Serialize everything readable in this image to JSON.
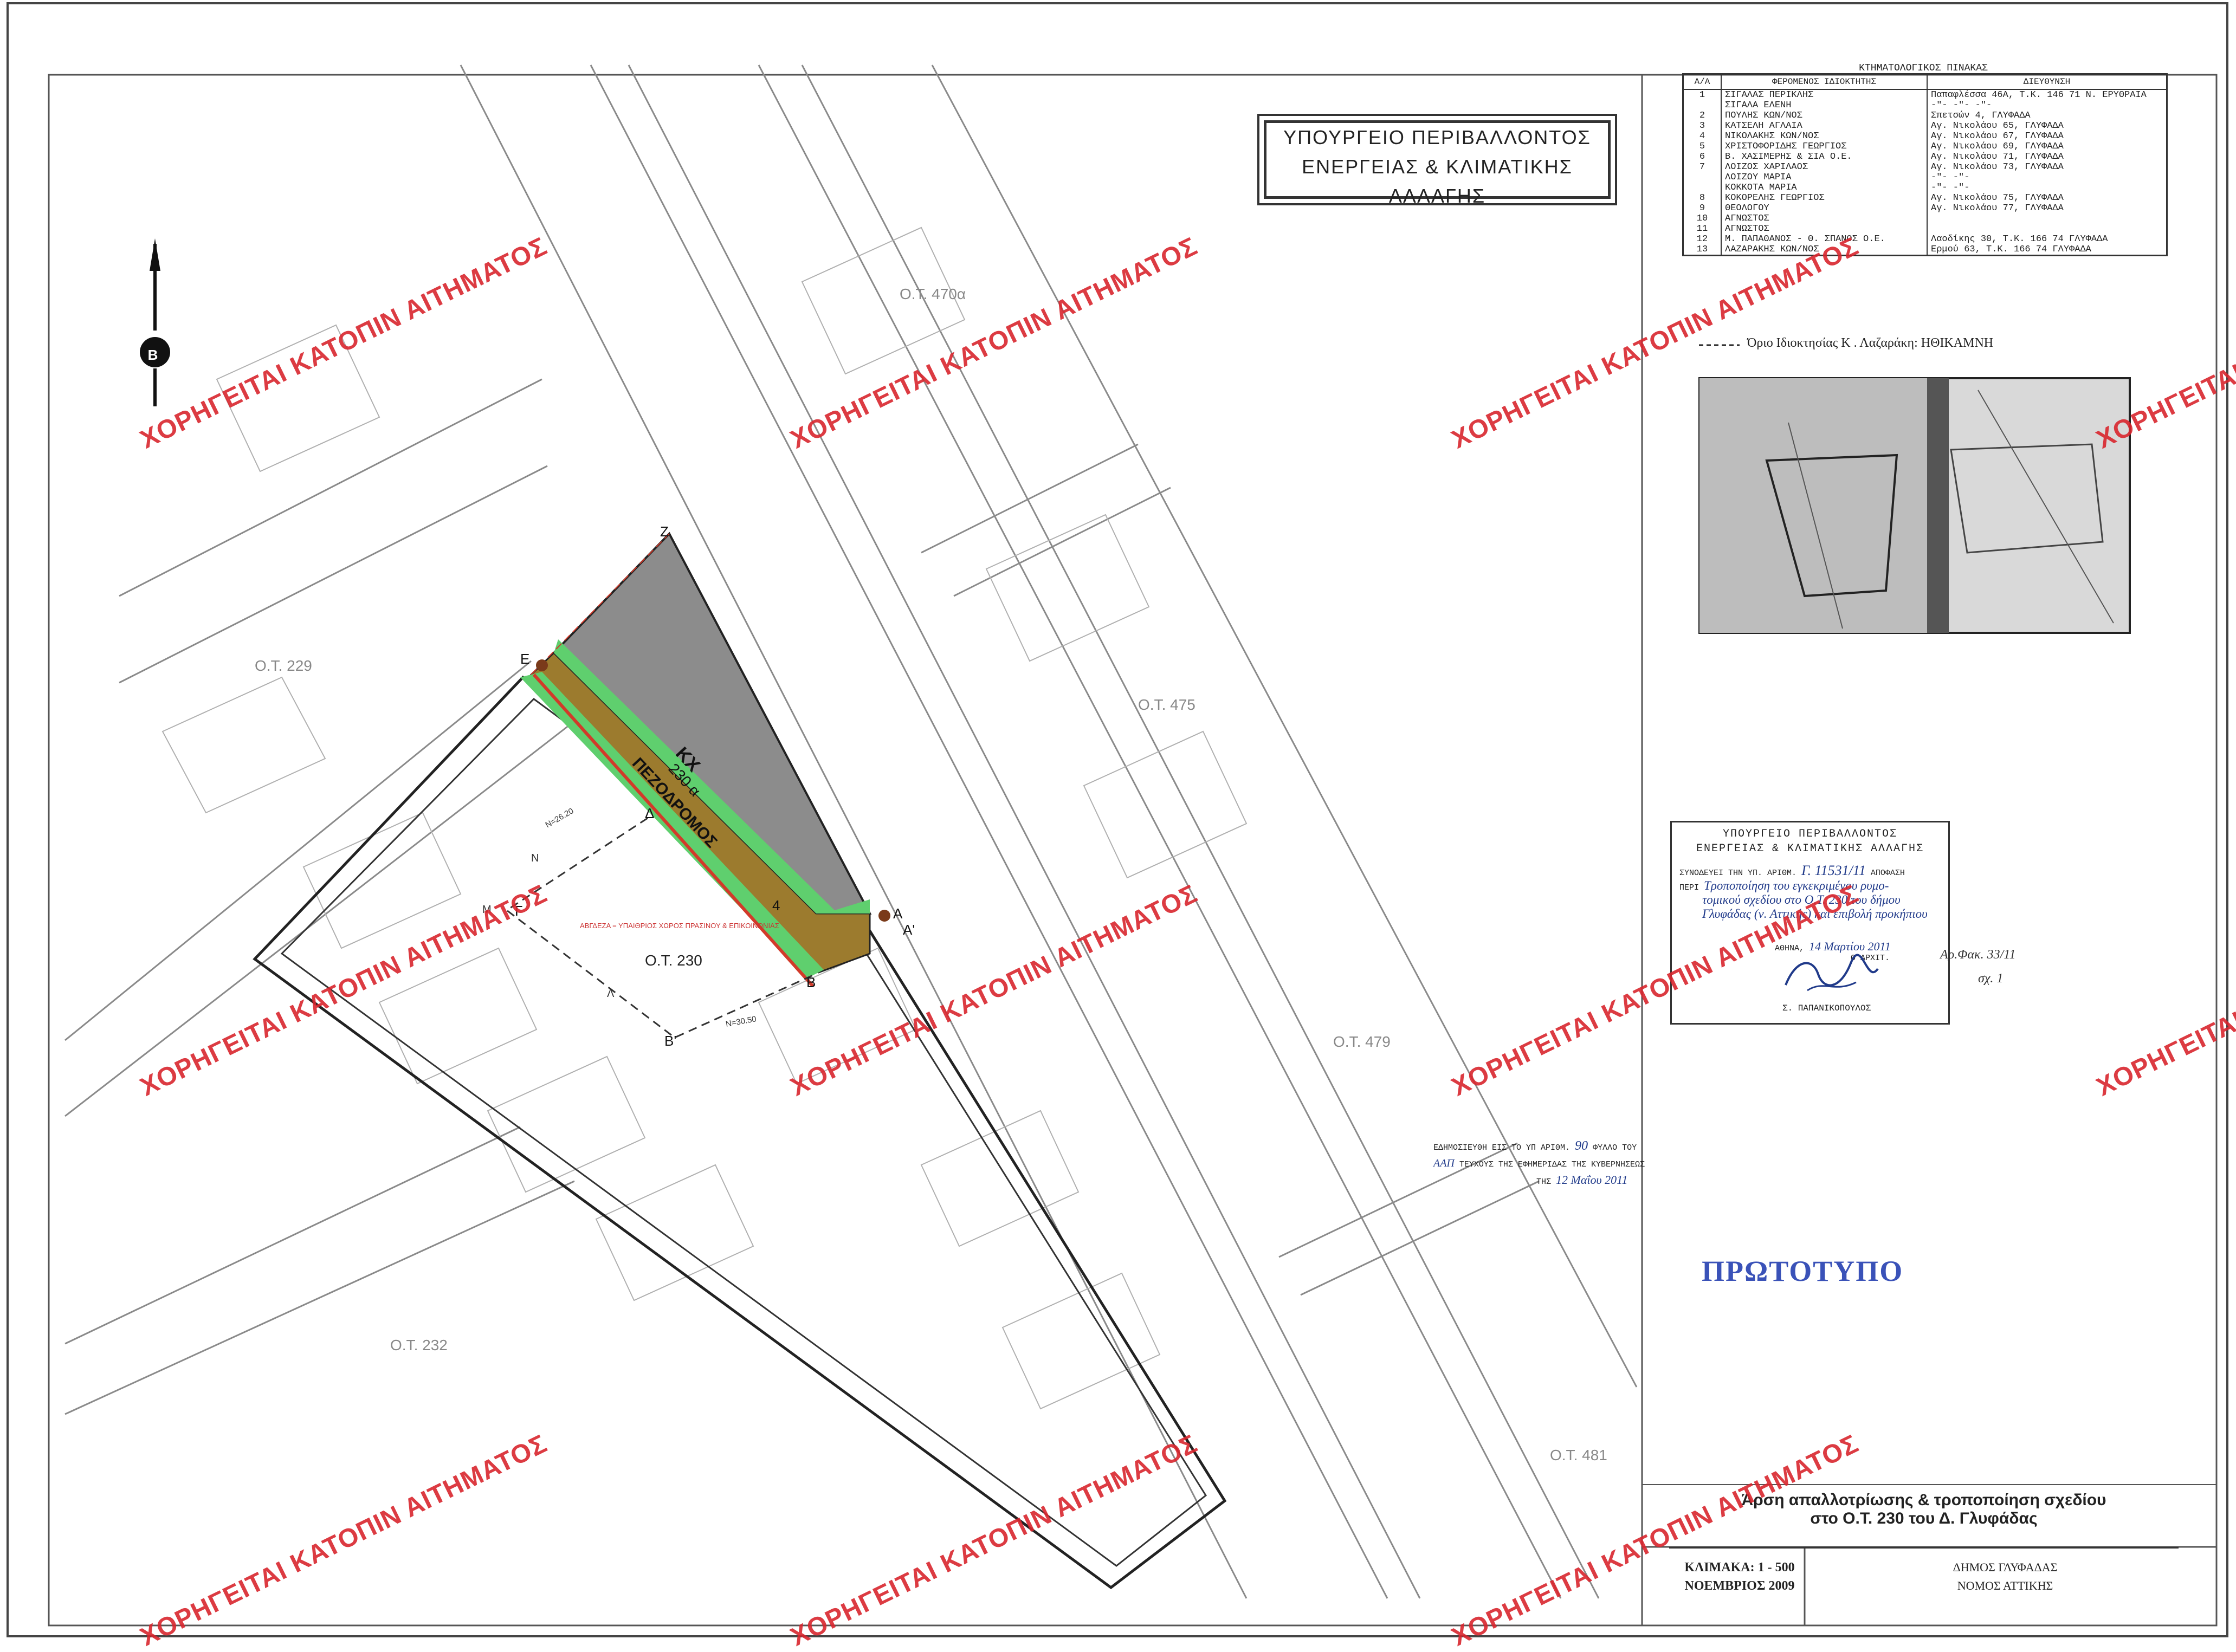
{
  "ministry": {
    "line1": "ΥΠΟΥΡΓΕΙΟ ΠΕΡΙΒΑΛΛΟΝΤΟΣ",
    "line2": "ΕΝΕΡΓΕΙΑΣ & ΚΛΙΜΑΤΙΚΗΣ ΑΛΛΑΓΗΣ"
  },
  "owners_table": {
    "title": "ΚΤΗΜΑΤΟΛΟΓΙΚΟΣ ΠΙΝΑΚΑΣ",
    "headers": [
      "Α/Α",
      "ΦΕΡΟΜΕΝΟΣ ΙΔΙΟΚΤΗΤΗΣ",
      "ΔΙΕΥΘΥΝΣΗ"
    ],
    "rows": [
      [
        "1",
        "ΣΙΓΑΛΑΣ ΠΕΡΙΚΛΗΣ",
        "Παπαφλέσσα 46Α, Τ.Κ. 146 71 Ν. ΕΡΥΘΡΑΙΑ"
      ],
      [
        "",
        "ΣΙΓΑΛΑ ΕΛΕΝΗ",
        "-\"-        -\"-       -\"-"
      ],
      [
        "2",
        "ΠΟΥΛΗΣ ΚΩΝ/ΝΟΣ",
        "Σπετσών 4, ΓΛΥΦΑΔΑ"
      ],
      [
        "3",
        "ΚΑΤΣΕΛΗ ΑΓΛΑΙΑ",
        "Αγ. Νικολάου 65, ΓΛΥΦΑΔΑ"
      ],
      [
        "4",
        "ΝΙΚΟΛΑΚΗΣ ΚΩΝ/ΝΟΣ",
        "Αγ. Νικολάου 67, ΓΛΥΦΑΔΑ"
      ],
      [
        "5",
        "ΧΡΙΣΤΟΦΟΡΙΔΗΣ ΓΕΩΡΓΙΟΣ",
        "Αγ. Νικολάου 69, ΓΛΥΦΑΔΑ"
      ],
      [
        "6",
        "Β. ΧΑΣΙΜΕΡΗΣ & ΣΙΑ Ο.Ε.",
        "Αγ. Νικολάου 71, ΓΛΥΦΑΔΑ"
      ],
      [
        "7",
        "ΛΟΙΖΟΣ ΧΑΡΙΛΑΟΣ",
        "Αγ. Νικολάου 73, ΓΛΥΦΑΔΑ"
      ],
      [
        "",
        "ΛΟΙΖΟΥ ΜΑΡΙΑ",
        "-\"-      -\"-"
      ],
      [
        "",
        "ΚΟΚΚΟΤΑ ΜΑΡΙΑ",
        "-\"-      -\"-"
      ],
      [
        "8",
        "ΚΟΚΟΡΕΛΗΣ ΓΕΩΡΓΙΟΣ",
        "Αγ. Νικολάου 75, ΓΛΥΦΑΔΑ"
      ],
      [
        "9",
        "ΘΕΟΛΟΓΟΥ",
        "Αγ. Νικολάου 77, ΓΛΥΦΑΔΑ"
      ],
      [
        "10",
        "ΑΓΝΩΣΤΟΣ",
        ""
      ],
      [
        "11",
        "ΑΓΝΩΣΤΟΣ",
        ""
      ],
      [
        "12",
        "Μ. ΠΑΠΑΘΑΝΟΣ - Θ. ΣΠΑΝΟΣ Ο.Ε.",
        "Λαοδίκης 30, Τ.Κ. 166 74 ΓΛΥΦΑΔΑ"
      ],
      [
        "13",
        "ΛΑΖΑΡΑΚΗΣ ΚΩΝ/ΝΟΣ",
        "Ερμού 63, Τ.Κ. 166 74 ΓΛΥΦΑΔΑ"
      ]
    ]
  },
  "boundary_note": "Όριο Ιδιοκτησίας Κ . Λαζαράκη: ΗΘΙΚΑΜΝΗ",
  "map": {
    "north_label": "Β",
    "block_labels": [
      "Ο.Τ. 229",
      "Ο.Τ. 230",
      "Ο.Τ. 475",
      "Ο.Τ. 479",
      "Ο.Τ. 470α",
      "Ο.Τ. 232",
      "Ο.Τ. 481"
    ],
    "points": [
      "Z",
      "E",
      "A",
      "A'",
      "B",
      "B'",
      "Γ",
      "Δ",
      "Λ",
      "Μ",
      "N"
    ],
    "kx_label": "ΚΧ",
    "kx_area": "230 α",
    "pedestrian_label": "ΠΕΖΟΔΡΟΜΟΣ",
    "strip_number": "4",
    "zone_label": "ΑΒΓΔΕΖΑ = ΥΠΑΙΘΡΙΟΣ ΧΩΡΟΣ ΠΡΑΣΙΝΟΥ & ΕΠΙΚΟΙΝΩΝΙΑΣ",
    "dim_labels": [
      "Ν=26.20",
      "Ν=30.50"
    ]
  },
  "watermark": "ΧΟΡΗΓΕΙΤΑΙ ΚΑΤΟΠΙΝ ΑΙΤΗΜΑΤΟΣ",
  "stamp": {
    "line1": "ΥΠΟΥΡΓΕΙΟ ΠΕΡΙΒΑΛΛΟΝΤΟΣ",
    "line2": "ΕΝΕΡΓΕΙΑΣ & ΚΛΙΜΑΤΙΚΗΣ ΑΛΛΑΓΗΣ",
    "attach_prefix": "ΣΥΝΟΔΕΥΕΙ ΤΗΝ ΥΠ. ΑΡΙΘΜ.",
    "decision_no": "Γ. 11531/11",
    "decision_word": "ΑΠΟΦΑΣΗ",
    "peri": "ΠΕΡΙ",
    "hw_text": [
      "Τροποποίηση του εγκεκριμένου ρυμο-",
      "τομικού σχεδίου στο Ο.Τ. 230 του δήμου",
      "Γλυφάδας (ν. Αττικής) και επιβολή προκήπιου"
    ],
    "date_prefix": "ΑΘΗΝΑ,",
    "date_hw": "14 Μαρτίου 2011",
    "signer_role": "Ο ΑΡΧΙΤ.",
    "signer": "Σ. ΠΑΠΑΝΙΚΟΠΟΥΛΟΣ"
  },
  "side_note": {
    "line1": "Αρ.Φακ. 33/11",
    "line2": "σχ. 1"
  },
  "publication": {
    "l1a": "ΕΔΗΜΟΣΙΕΥΘΗ ΕΙΣ ΤΟ ΥΠ ΑΡΙΘΜ.",
    "number": "90",
    "l1b": "ΦΥΛΛΟ ΤΟΥ",
    "series": "ΑΑΠ",
    "l2": "ΤΕΥΧΟΥΣ ΤΗΣ ΕΦΗΜΕΡΙΔΑΣ ΤΗΣ ΚΥΒΕΡΝΗΣΕΩΣ",
    "l3": "ΤΗΣ",
    "date": "12 Μαΐου 2011"
  },
  "prototype_stamp": "ΠΡΩΤΟΤΥΠΟ",
  "title": {
    "line1": "Άρση απαλλοτρίωσης & τροποποίηση σχεδίου",
    "line2": "στο Ο.Τ. 230 του Δ. Γλυφάδας"
  },
  "scale": {
    "label": "ΚΛΙΜΑΚΑ: 1 - 500",
    "date": "ΝΟΕΜΒΡΙΟΣ 2009"
  },
  "municipality": {
    "line1": "ΔΗΜΟΣ ΓΛΥΦΑΔΑΣ",
    "line2": "ΝΟΜΟΣ ΑΤΤΙΚΗΣ"
  },
  "colors": {
    "green": "#5fcf6e",
    "brown": "#9c7b2e",
    "kx_gray": "#8c8c8c",
    "red_line": "#d23a2a",
    "watermark": "#d9262e",
    "stamp_blue": "#3a52b8"
  }
}
